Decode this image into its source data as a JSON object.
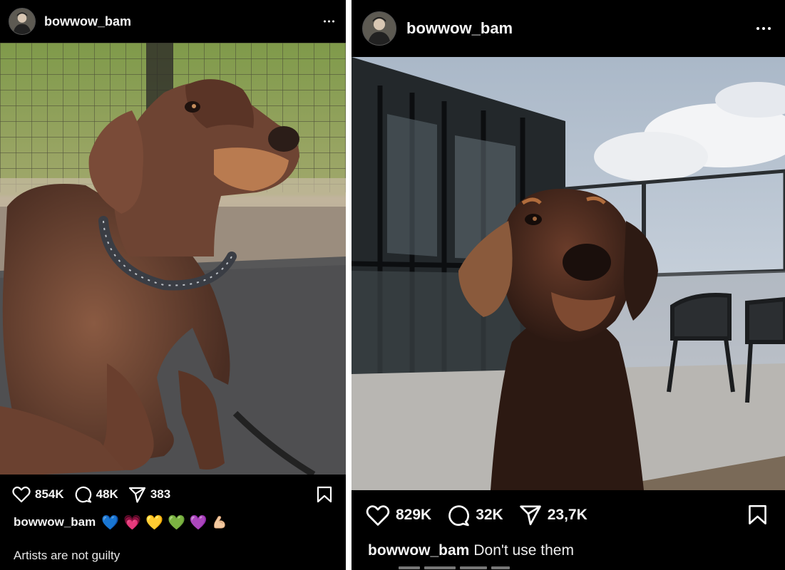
{
  "posts": [
    {
      "username": "bowwow_bam",
      "likes": "854K",
      "comments": "48K",
      "shares": "383",
      "caption_emoji": [
        "💙",
        "💗",
        "💛",
        "💚",
        "💜",
        "💪🏼"
      ],
      "caption_line2": "Artists are not guilty",
      "photo_subject": "doberman-lying-on-rug"
    },
    {
      "username": "bowwow_bam",
      "likes": "829K",
      "comments": "32K",
      "shares": "23,7K",
      "caption_text": "Don't use them",
      "photo_subject": "doberman-on-rooftop-terrace"
    }
  ],
  "icons": [
    "heart-icon",
    "comment-icon",
    "share-icon",
    "bookmark-icon",
    "more-options-icon"
  ],
  "colors": {
    "background": "#000000",
    "text": "#f5f5f5",
    "divider": "#ffffff"
  }
}
